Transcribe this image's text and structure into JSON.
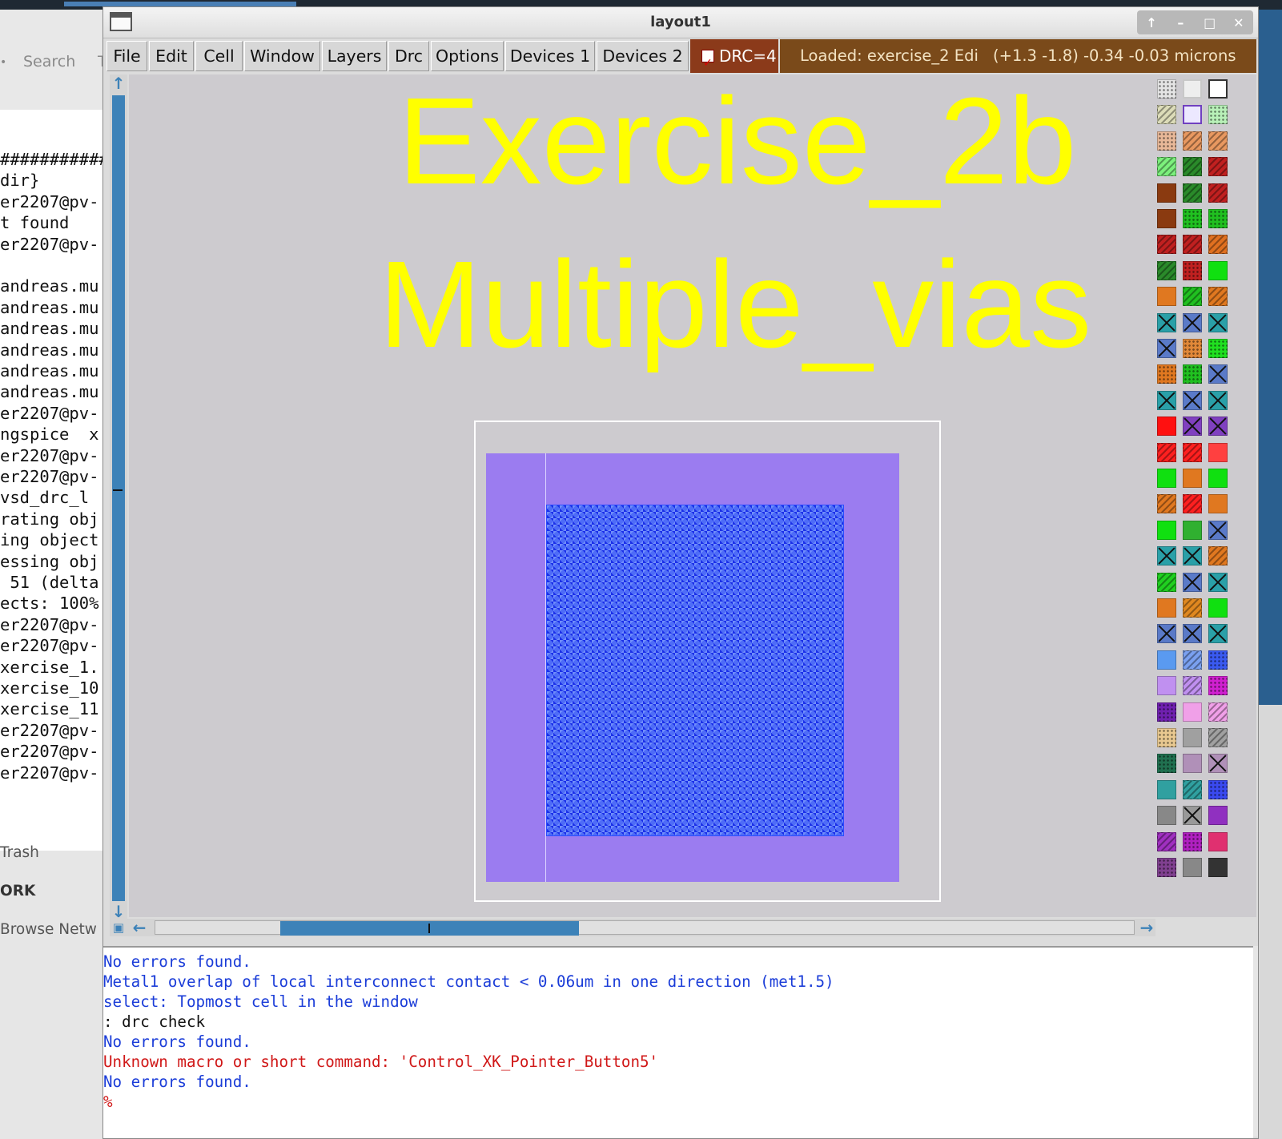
{
  "background": {
    "file_manager": {
      "search_label": "Search",
      "t_label": "T",
      "dot_label": "•",
      "sidebar": [
        {
          "label": "Trash",
          "bold": false
        },
        {
          "label": "ORK",
          "bold": true
        },
        {
          "label": "Browse Netw",
          "bold": false
        }
      ]
    },
    "terminal_lines": [
      "############",
      "dir}",
      "er2207@pv-",
      "t found",
      "er2207@pv-",
      "",
      "andreas.mu",
      "andreas.mu",
      "andreas.mu",
      "andreas.mu",
      "andreas.mu",
      "andreas.mu",
      "er2207@pv-",
      "ngspice  x",
      "er2207@pv-",
      "er2207@pv-",
      "vsd_drc_l",
      "rating obj",
      "ing object",
      "essing obj",
      " 51 (delta",
      "ects: 100%",
      "er2207@pv-",
      "er2207@pv-",
      "xercise_1.",
      "xercise_10",
      "xercise_11",
      "er2207@pv-",
      "er2207@pv-",
      "er2207@pv-"
    ]
  },
  "window": {
    "title": "layout1",
    "controls": [
      "↑",
      "–",
      "□",
      "✕"
    ]
  },
  "menu": {
    "items": [
      {
        "label": "File"
      },
      {
        "label": "Edit"
      },
      {
        "label": "Cell"
      },
      {
        "label": "Window"
      },
      {
        "label": "Layers"
      },
      {
        "label": "Drc"
      },
      {
        "label": "Options"
      },
      {
        "label": "Devices 1"
      },
      {
        "label": "Devices 2"
      }
    ],
    "drc_label": "DRC=4",
    "drc_checked": true,
    "status_loaded": "Loaded: exercise_2 Edi",
    "status_coords": "(+1.3 -1.8) -0.34 -0.03 microns"
  },
  "canvas": {
    "label_line1": "Exercise_2b",
    "label_line2": "Multiple_vias",
    "label_color": "#ffff00",
    "metal_color": "#9b7cf0",
    "via_color": "#4e6cf7",
    "background_color": "#cdcbcf"
  },
  "scrollbars": {
    "up_icon": "↑",
    "down_icon": "↓",
    "left_icon": "←",
    "right_icon": "→",
    "corner_icon": "▣"
  },
  "palette": {
    "swatches": [
      [
        "#e4e4e4|dots",
        "#eeeeee|outline-light",
        "#ffffff|outline"
      ],
      [
        "#dcdcb8|hatch",
        "#ece8ff|outline-purple",
        "#b8f0b8|dots"
      ],
      [
        "#e8b898|dots",
        "#e89860|hatch",
        "#e89860|hatch"
      ],
      [
        "#7cf07c|hatch",
        "#2a8a2a|hatch",
        "#c02020|hatch"
      ],
      [
        "#8a3a10|solid",
        "#2a8a2a|hatch",
        "#c02020|hatch"
      ],
      [
        "#8a3a10|solid",
        "#20c020|dots",
        "#20c020|dots"
      ],
      [
        "#c02020|hatch",
        "#c02020|hatch",
        "#e07020|hatch"
      ],
      [
        "#2a8a2a|hatch",
        "#c02020|dots",
        "#10e010|solid"
      ],
      [
        "#e07820|solid",
        "#20c020|hatch",
        "#e07820|hatch"
      ],
      [
        "#2aa0a8|x",
        "#5a7ac8|x",
        "#2aa0a8|x"
      ],
      [
        "#5a7ac8|x",
        "#e08838|dots",
        "#20e020|dots"
      ],
      [
        "#e07820|dots",
        "#20c020|dots",
        "#5a7ac8|x"
      ],
      [
        "#2aa0a8|x",
        "#5a7ac8|x",
        "#2aa0a8|x"
      ],
      [
        "#ff1010|solid",
        "#8040c0|x",
        "#8040c0|x"
      ],
      [
        "#ff2020|hatch",
        "#ff2020|hatch",
        "#ff4040|solid"
      ],
      [
        "#10e010|solid",
        "#e07820|solid",
        "#10e010|solid"
      ],
      [
        "#e07820|hatch",
        "#ff2020|hatch",
        "#e07820|solid"
      ],
      [
        "#10e010|solid",
        "#30b030|solid",
        "#5a7ac8|x"
      ],
      [
        "#2aa0a8|x",
        "#2aa0a8|x",
        "#e07820|hatch"
      ],
      [
        "#20d020|hatch",
        "#5a7ac8|x",
        "#2aa0a8|x"
      ],
      [
        "#e07820|solid",
        "#e08820|hatch",
        "#10e010|solid"
      ],
      [
        "#5a7ac8|x",
        "#5a7ac8|x",
        "#2aa0a8|x"
      ],
      [
        "#5a9af0|solid",
        "#7aa0f0|hatch",
        "#3a5af0|dots"
      ],
      [
        "#c090f0|solid",
        "#c090f0|hatch",
        "#d020d0|dots"
      ],
      [
        "#7020b0|dots",
        "#f0a0e8|solid",
        "#f0a0e8|hatch"
      ],
      [
        "#e8c890|dots",
        "#a0a0a0|solid",
        "#a0a0a0|hatch"
      ],
      [
        "#207050|dots",
        "#b090b8|solid",
        "#b090b8|x"
      ],
      [
        "#30a0a0|solid",
        "#30a0a0|hatch",
        "#3a4af0|dots"
      ],
      [
        "#888888|solid",
        "#999999|x",
        "#9030c0|solid"
      ],
      [
        "#a030c0|hatch",
        "#b020c0|dots",
        "#e03070|solid"
      ],
      [
        "#804090|dots",
        "#888888|solid",
        "#333333|solid"
      ]
    ]
  },
  "console": {
    "lines": [
      {
        "text": "No errors found.",
        "color": "blue"
      },
      {
        "text": "Metal1 overlap of local interconnect contact < 0.06um in one direction (met1.5)",
        "color": "blue"
      },
      {
        "text": "select: Topmost cell in the window",
        "color": "blue"
      },
      {
        "text": ": drc check",
        "color": "black"
      },
      {
        "text": "No errors found.",
        "color": "blue"
      },
      {
        "text": "Unknown macro or short command: 'Control_XK_Pointer_Button5'",
        "color": "red"
      },
      {
        "text": "No errors found.",
        "color": "blue"
      },
      {
        "text": "%",
        "color": "red"
      }
    ]
  }
}
